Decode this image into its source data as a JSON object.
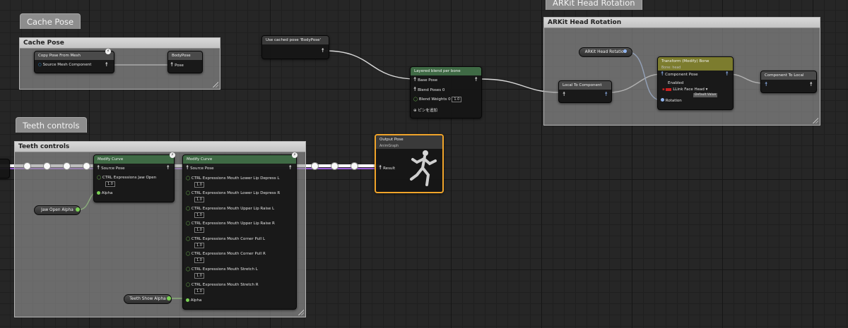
{
  "comments": {
    "cache_pose": "Cache Pose",
    "teeth_controls": "Teeth controls",
    "arkit_head_rotation": "ARKit Head Rotation"
  },
  "nodes": {
    "copy_pose": {
      "title": "Copy Pose From Mesh",
      "pin": "Source Mesh Component"
    },
    "body_pose": {
      "title": "BodyPose",
      "pin": "Pose"
    },
    "use_cached_pose": {
      "title": "Use cached pose 'BodyPose'"
    },
    "layered_blend": {
      "title": "Layered blend per bone",
      "pin_base": "Base Pose",
      "pin_blend": "Blend Poses 0",
      "pin_weights": "Blend Weights 0",
      "weights_value": "1.0",
      "add_pin": "ピンを追加"
    },
    "arkit_rotation_getter": "ARKit Head Rotation",
    "local_to_component": {
      "title": "Local To Component"
    },
    "transform_bone": {
      "title": "Transform (Modify) Bone",
      "subtitle": "Bone: head",
      "pin_component": "Component Pose",
      "pin_enabled": "Enabled",
      "link_label": "LLink Face Head",
      "tooltip": "Default Value",
      "pin_rotation": "Rotation"
    },
    "component_to_local": {
      "title": "Component To Local"
    },
    "output_pose": {
      "title": "Output Pose",
      "subtitle": "AnimGraph",
      "pin": "Result"
    },
    "modify_curve_1": {
      "title": "Modify Curve",
      "pin_source": "Source Pose",
      "curve": "CTRL Expressions Jaw Open",
      "value": "1.0",
      "pin_alpha": "Alpha"
    },
    "modify_curve_2": {
      "title": "Modify Curve",
      "pin_source": "Source Pose",
      "curves": [
        {
          "name": "CTRL Expressions Mouth Lower Lip Depress L",
          "value": "1.0"
        },
        {
          "name": "CTRL Expressions Mouth Lower Lip Depress R",
          "value": "1.0"
        },
        {
          "name": "CTRL Expressions Mouth Upper Lip Raise L",
          "value": "1.0"
        },
        {
          "name": "CTRL Expressions Mouth Upper Lip Raise R",
          "value": "1.0"
        },
        {
          "name": "CTRL Expressions Mouth Corner Pull L",
          "value": "1.0"
        },
        {
          "name": "CTRL Expressions Mouth Corner Pull R",
          "value": "1.0"
        },
        {
          "name": "CTRL Expressions Mouth Stretch L",
          "value": "1.0"
        },
        {
          "name": "CTRL Expressions Mouth Stretch R",
          "value": "1.0"
        }
      ],
      "pin_alpha": "Alpha"
    },
    "jaw_open_alpha": "Jaw Open Alpha",
    "teeth_show_alpha": "Teeth Show Alpha"
  },
  "colors": {
    "header_anim": "#3f6a45",
    "header_transform": "#7c7c2e",
    "header_gray": "#4a4a4a",
    "output_border": "#f0a42a",
    "float_pin": "#7ad154",
    "wire_purple": "#9a5cd6"
  }
}
